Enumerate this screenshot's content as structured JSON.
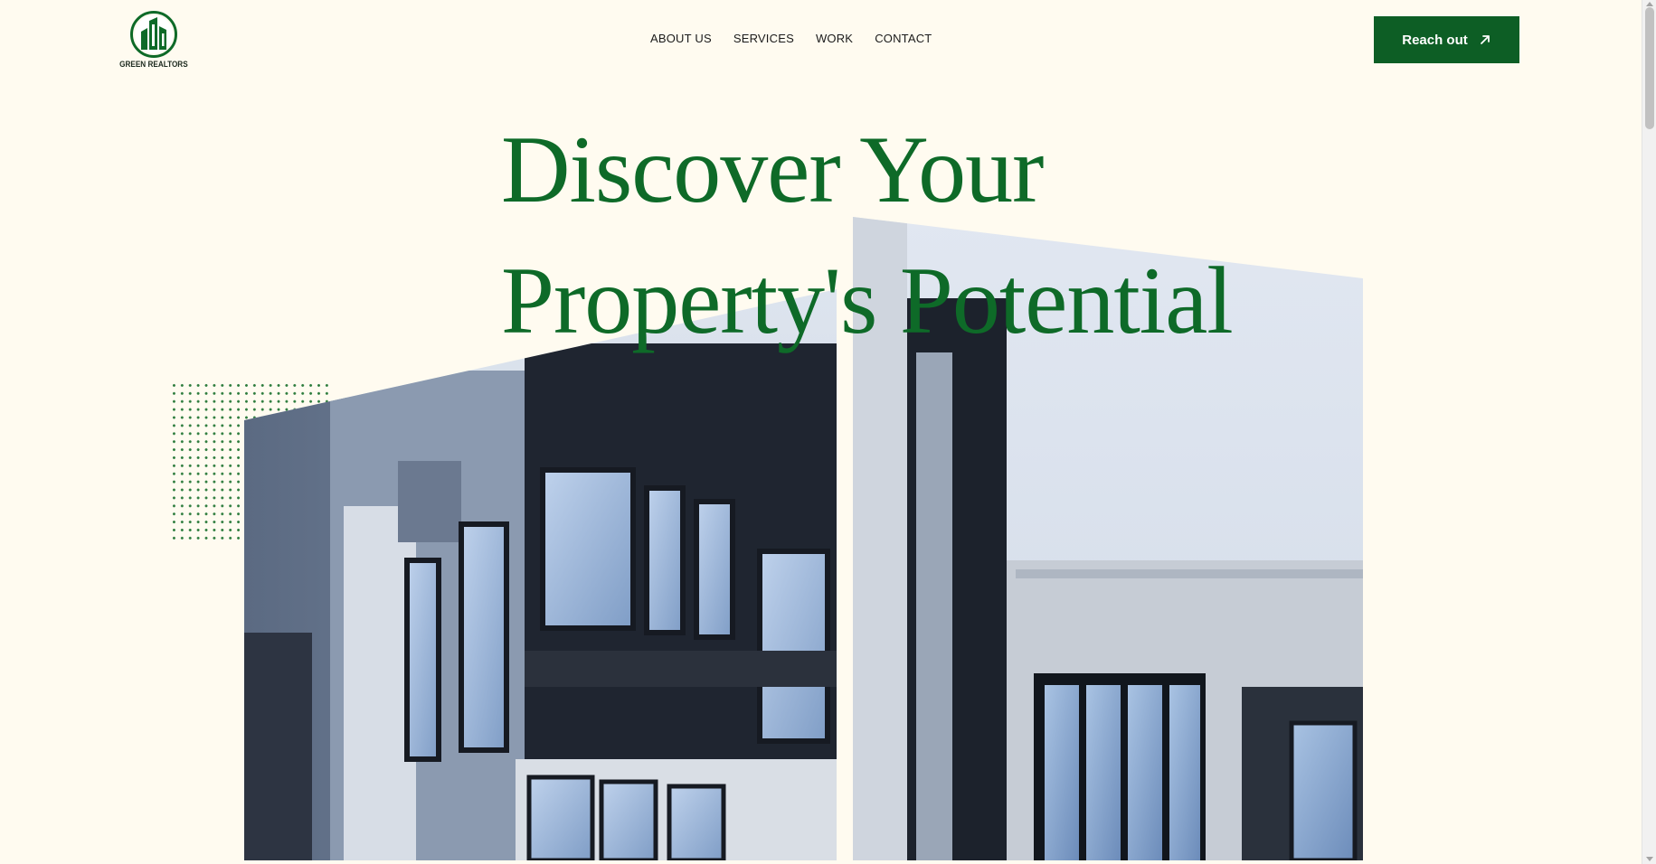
{
  "brand": {
    "name": "GREEN REALTORS",
    "logo_icon": "building-logo-icon",
    "color": "#0e6a28"
  },
  "nav": {
    "items": [
      {
        "label": "ABOUT US"
      },
      {
        "label": "SERVICES"
      },
      {
        "label": "WORK"
      },
      {
        "label": "CONTACT"
      }
    ]
  },
  "cta": {
    "label": "Reach out",
    "icon": "arrow-up-right-icon",
    "background": "#0d5e25"
  },
  "hero": {
    "line1": "Discover Your",
    "line2": "Property's Potential"
  },
  "colors": {
    "page_background": "#fffbf0",
    "heading": "#0e6a28"
  }
}
